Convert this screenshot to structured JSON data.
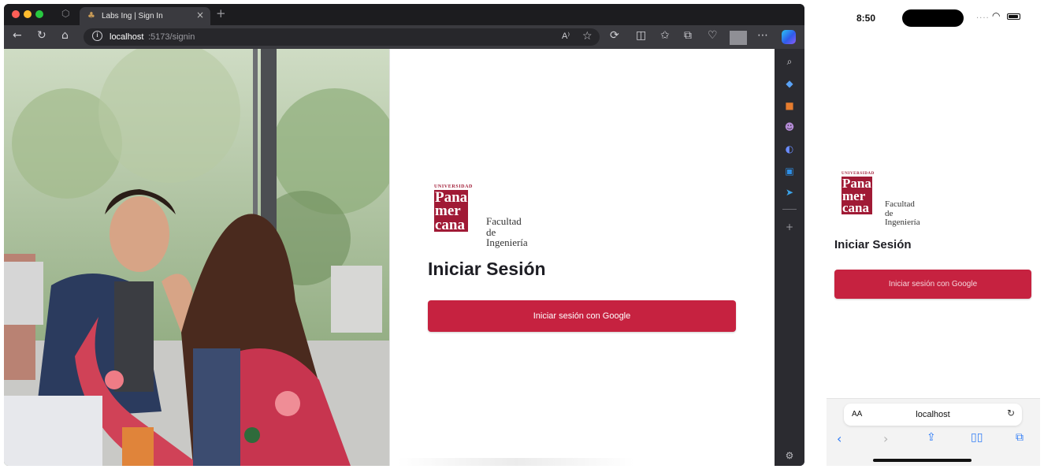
{
  "desktop": {
    "tab": {
      "title": "Labs Ing | Sign In",
      "close_glyph": "×",
      "favicon": "tree-icon"
    },
    "new_tab_glyph": "+",
    "address_bar": {
      "host": "localhost",
      "path": ":5173/signin",
      "read_aloud": "A⁾",
      "info_glyph": "i"
    },
    "toolbar_icons": [
      "back-icon",
      "reload-icon",
      "home-icon",
      "read-aloud-icon",
      "favorite-icon",
      "extensions-icon",
      "split-screen-icon",
      "favorites-icon",
      "collections-icon",
      "heart-icon",
      "profile-avatar",
      "more-icon",
      "copilot-icon"
    ],
    "sidebar_icons": [
      "search-icon",
      "tag-icon",
      "briefcase-icon",
      "people-icon",
      "copilot-icon",
      "outlook-icon",
      "send-icon",
      "add-icon",
      "settings-icon"
    ],
    "logo": {
      "university": "UNIVERSIDAD",
      "lines": [
        "Pana",
        "mer",
        "cana"
      ],
      "faculty_line1": "Facultad de",
      "faculty_line2": "Ingeniería"
    },
    "heading": "Iniciar Sesión",
    "google_button": "Iniciar sesión con Google",
    "colors": {
      "brand": "#A01A35",
      "button": "#C62240",
      "chrome": "#3A3A3F"
    }
  },
  "mobile": {
    "time": "8:50",
    "signal": "....",
    "logo": {
      "university": "UNIVERSIDAD",
      "lines": [
        "Pana",
        "mer",
        "cana"
      ],
      "faculty_line1": "Facultad de",
      "faculty_line2": "Ingeniería"
    },
    "heading": "Iniciar Sesión",
    "google_button": "Iniciar sesión con Google",
    "url_bar": {
      "aa": "AA",
      "host": "localhost"
    },
    "battery_level": 0.9
  }
}
